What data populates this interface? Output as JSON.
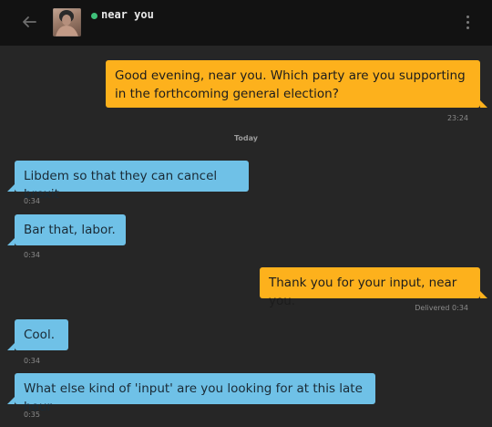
{
  "header": {
    "contact_name": "near you",
    "online_color": "#3fc17a",
    "back_icon": "arrow-left-icon",
    "menu_icon": "more-vertical-icon"
  },
  "colors": {
    "outgoing": "#fdb11c",
    "incoming": "#6fc1e7",
    "background": "#262626",
    "header": "#121212"
  },
  "day_separator": "Today",
  "messages": [
    {
      "direction": "out",
      "text": "Good evening, near you. Which party are you supporting in the forthcoming general election?",
      "meta": "23:24"
    },
    {
      "direction": "in",
      "text": "Libdem so that they can cancel brexit",
      "meta": "0:34"
    },
    {
      "direction": "in",
      "text": "Bar that, labor.",
      "meta": "0:34"
    },
    {
      "direction": "out",
      "text": "Thank you for your input, near you.",
      "meta": "Delivered 0:34"
    },
    {
      "direction": "in",
      "text": "Cool.",
      "meta": "0:34"
    },
    {
      "direction": "in",
      "text": "What else kind of 'input' are you looking for at this late hour",
      "meta": "0:35"
    }
  ]
}
